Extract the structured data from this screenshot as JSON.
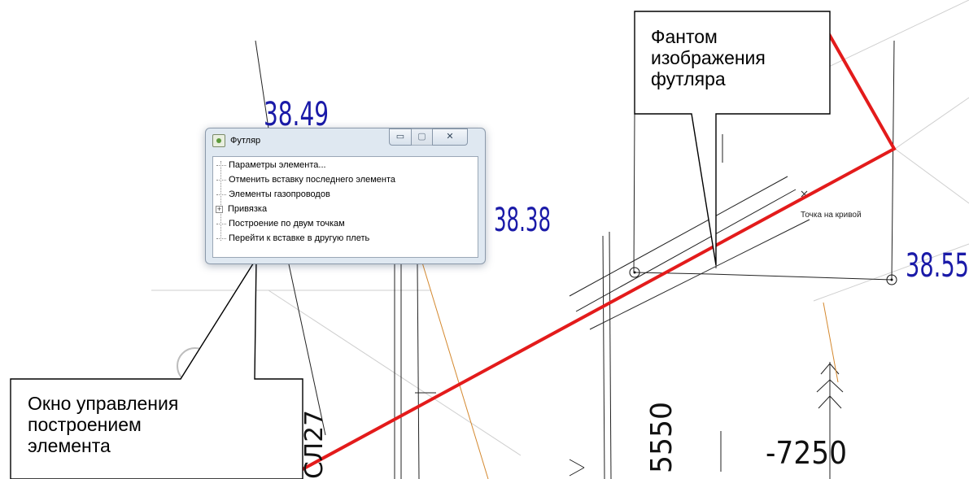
{
  "drawing": {
    "labels": {
      "dim_3849": "38.49",
      "dim_3838": "38.38",
      "dim_3855": "38.55",
      "dim_5550": "5550",
      "dim_7250": "-7250",
      "dim_cl27": "СЛ27",
      "point_on_curve": "Точка на кривой"
    },
    "colors": {
      "pipe": "#e31b1b",
      "dim_text": "#1a1aa8",
      "aux_line": "#d4882e"
    }
  },
  "dialog": {
    "title": "Футляр",
    "icon": "app-icon",
    "controls": {
      "minimize": "minimize-icon",
      "maximize": "maximize-icon",
      "close": "close-icon"
    },
    "items": [
      {
        "label": "Параметры элемента..."
      },
      {
        "label": "Отменить вставку последнего элемента"
      },
      {
        "label": "Элементы газопроводов"
      },
      {
        "label": "Привязка",
        "expandable": true
      },
      {
        "label": "Построение по двум точкам"
      },
      {
        "label": "Перейти к вставке  в другую плеть"
      }
    ]
  },
  "callouts": {
    "phantom": {
      "lines": [
        "Фантом",
        "изображения",
        "футляра"
      ]
    },
    "window": {
      "lines": [
        "Окно управления",
        "построением",
        "элемента"
      ]
    }
  }
}
